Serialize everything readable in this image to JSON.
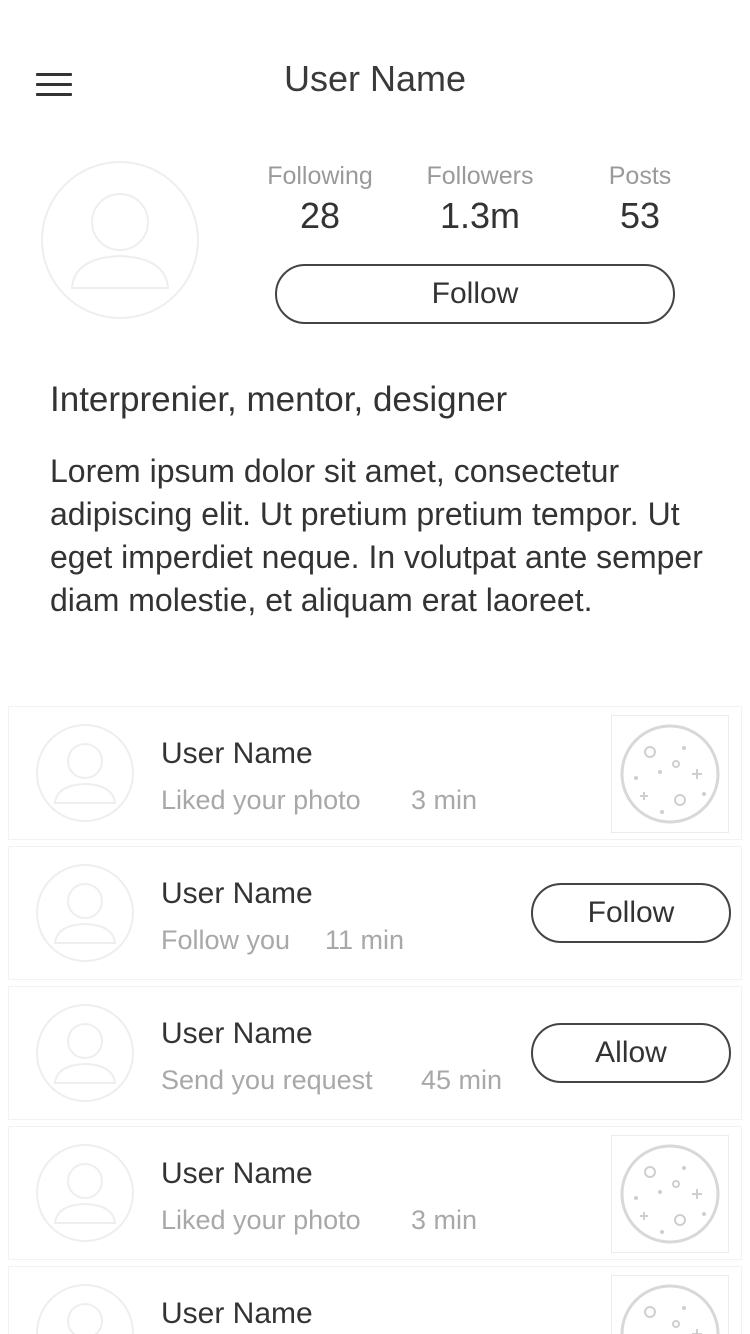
{
  "header": {
    "title": "User Name"
  },
  "stats": [
    {
      "label": "Following",
      "value": "28"
    },
    {
      "label": "Followers",
      "value": "1.3m"
    },
    {
      "label": "Posts",
      "value": "53"
    }
  ],
  "profile": {
    "follow_label": "Follow"
  },
  "bio": {
    "headline": "Interprenier, mentor, designer",
    "text": "Lorem ipsum dolor sit amet, consectetur adipiscing elit. Ut pretium pretium tempor. Ut eget imperdiet neque. In volutpat ante semper diam molestie, et aliquam erat laoreet."
  },
  "notifications": [
    {
      "name": "User Name",
      "action": "Liked your photo",
      "time": "3 min",
      "trailing": "thumbnail"
    },
    {
      "name": "User Name",
      "action": "Follow you",
      "time": "11 min",
      "trailing": "button",
      "button_label": "Follow"
    },
    {
      "name": "User Name",
      "action": "Send you request",
      "time": "45 min",
      "trailing": "button",
      "button_label": "Allow"
    },
    {
      "name": "User Name",
      "action": "Liked your photo",
      "time": "3 min",
      "trailing": "thumbnail"
    },
    {
      "name": "User Name",
      "action": "",
      "time": "",
      "trailing": "thumbnail"
    }
  ],
  "icons": {
    "menu": "hamburger-menu-icon",
    "avatar": "user-avatar-placeholder-icon",
    "thumbnail": "photo-thumbnail-icon"
  },
  "colors": {
    "text": "#333333",
    "muted": "#9a9a9a",
    "placeholder": "#eeeeee",
    "border": "#444444"
  }
}
